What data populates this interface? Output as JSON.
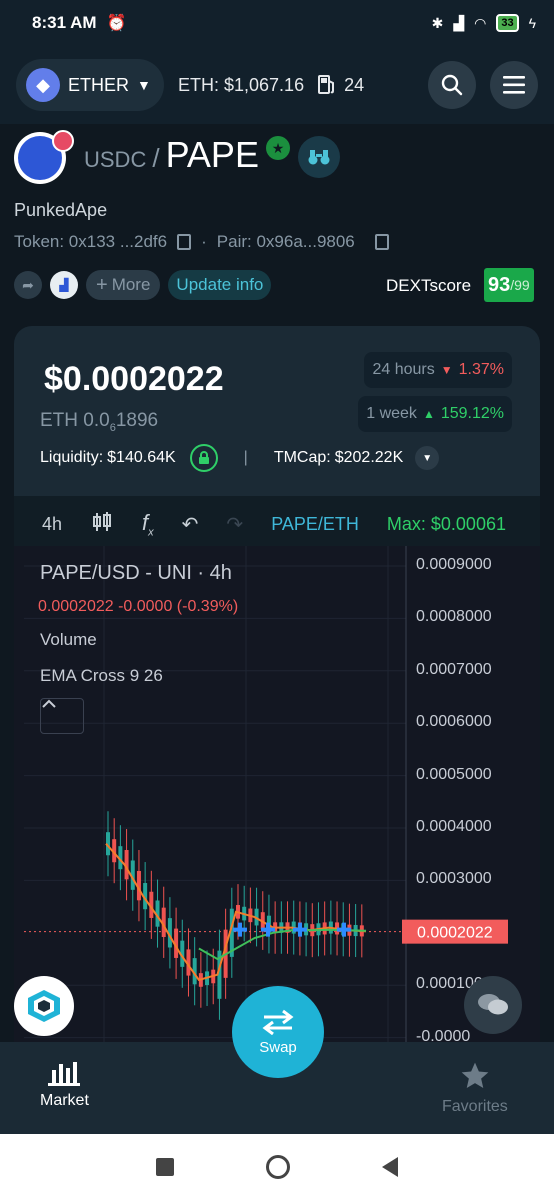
{
  "status": {
    "time": "8:31 AM",
    "battery": "33"
  },
  "nav": {
    "chain": "ETHER",
    "eth_price": "ETH: $1,067.16",
    "gas": "24"
  },
  "pair": {
    "quote": "USDC",
    "separator": "/",
    "base": "PAPE",
    "name": "PunkedApe",
    "token_addr": "Token: 0x133 ...2df6",
    "pair_addr": "Pair: 0x96a...9806",
    "dot": "·"
  },
  "actions": {
    "more": "More",
    "update": "Update info"
  },
  "dext": {
    "label": "DEXTscore",
    "score": "93",
    "of": "/99"
  },
  "price": {
    "usd": "$0.0002022",
    "eth_prefix": "ETH 0.0",
    "eth_sub": "6",
    "eth_suffix": "1896",
    "change_24h_label": "24 hours",
    "change_24h": "1.37%",
    "change_1w_label": "1 week",
    "change_1w": "159.12%",
    "liquidity_label": "Liquidity:",
    "liquidity": "$140.64K",
    "separator": "|",
    "tmcap_label": "TMCap:",
    "tmcap": "$202.22K"
  },
  "chart_toolbar": {
    "interval": "4h",
    "pair": "PAPE/ETH",
    "max": "Max: $0.00061"
  },
  "chart_legend": {
    "title": "PAPE/USD - UNI · 4h",
    "ohlc": "0.0002022  -0.0000 (-0.39%)",
    "volume": "Volume",
    "indicator": "EMA Cross 9 26"
  },
  "chart_data": {
    "type": "line",
    "y_ticks": [
      "0.0009000",
      "0.0008000",
      "0.0007000",
      "0.0006000",
      "0.0005000",
      "0.0004000",
      "0.0003000",
      "0.0001000",
      "-0.0000"
    ],
    "ylim": [
      0,
      0.0009
    ],
    "current_price_label": "0.0002022",
    "current_price": 0.0002022,
    "series": [
      {
        "color": "#f57c2a",
        "values": [
          0.00037,
          0.00033,
          0.00027,
          0.00022,
          0.00016,
          0.00011,
          0.00012,
          0.00024,
          0.00023,
          0.00021,
          0.00021,
          0.000205,
          0.00021,
          0.000205,
          0.000203
        ]
      },
      {
        "color": "#3fbf5a",
        "values": [
          null,
          null,
          null,
          null,
          null,
          0.00017,
          0.00015,
          0.00017,
          0.00019,
          0.0002,
          0.000205,
          0.000205,
          0.000206,
          0.000205,
          0.000204
        ]
      }
    ]
  },
  "bottom_nav": {
    "market": "Market",
    "swap": "Swap",
    "favorites": "Favorites"
  }
}
